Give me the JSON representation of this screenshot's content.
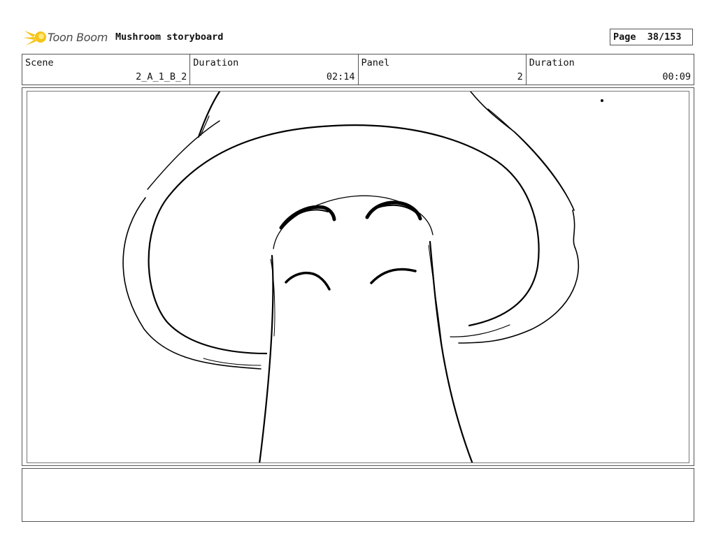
{
  "header": {
    "brand": "Toon Boom",
    "brand_color": "#f5c518",
    "title": "Mushroom storyboard",
    "page_label": "Page",
    "page_value": "38/153"
  },
  "info": {
    "scene_label": "Scene",
    "scene_value": "2_A_1_B_2",
    "scene_duration_label": "Duration",
    "scene_duration_value": "02:14",
    "panel_label": "Panel",
    "panel_value": "2",
    "panel_duration_label": "Duration",
    "panel_duration_value": "00:09"
  },
  "panel": {
    "drawing": "mushroom-character-sketch"
  },
  "notes": {
    "text": ""
  }
}
